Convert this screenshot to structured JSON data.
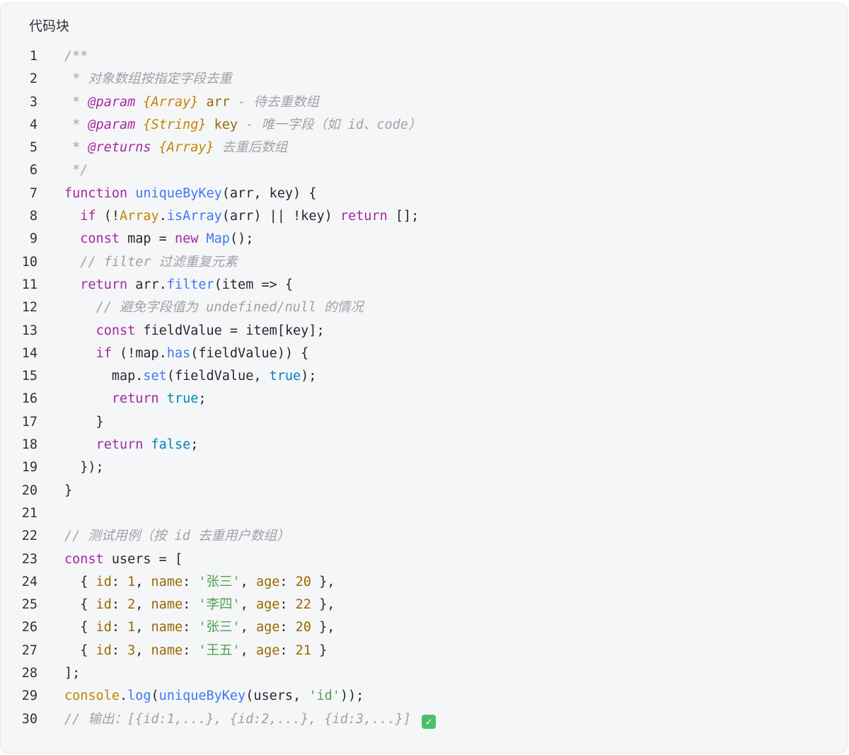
{
  "header": {
    "title": "代码块"
  },
  "theme": {
    "background": "#f5f6f7",
    "keyword": "#a626a4",
    "function": "#4078f2",
    "comment": "#a0a1a7",
    "string": "#50a14f",
    "number": "#986801",
    "boolean": "#0184bc",
    "type": "#c18401"
  },
  "code": {
    "language": "javascript",
    "lines": [
      {
        "n": "1",
        "tokens": [
          [
            "c",
            "/**"
          ]
        ]
      },
      {
        "n": "2",
        "tokens": [
          [
            "c",
            " * 对象数组按指定字段去重"
          ]
        ]
      },
      {
        "n": "3",
        "tokens": [
          [
            "c",
            " * "
          ],
          [
            "tag",
            "@param"
          ],
          [
            "c",
            " "
          ],
          [
            "type",
            "{Array}"
          ],
          [
            "c",
            " "
          ],
          [
            "prop",
            "arr"
          ],
          [
            "c",
            " - 待去重数组"
          ]
        ]
      },
      {
        "n": "4",
        "tokens": [
          [
            "c",
            " * "
          ],
          [
            "tag",
            "@param"
          ],
          [
            "c",
            " "
          ],
          [
            "type",
            "{String}"
          ],
          [
            "c",
            " "
          ],
          [
            "prop",
            "key"
          ],
          [
            "c",
            " - 唯一字段（如 id、code）"
          ]
        ]
      },
      {
        "n": "5",
        "tokens": [
          [
            "c",
            " * "
          ],
          [
            "tag",
            "@returns"
          ],
          [
            "c",
            " "
          ],
          [
            "type",
            "{Array}"
          ],
          [
            "c",
            " 去重后数组"
          ]
        ]
      },
      {
        "n": "6",
        "tokens": [
          [
            "c",
            " */"
          ]
        ]
      },
      {
        "n": "7",
        "tokens": [
          [
            "kw",
            "function"
          ],
          [
            "p",
            " "
          ],
          [
            "fn",
            "uniqueByKey"
          ],
          [
            "p",
            "(arr, key) {"
          ]
        ]
      },
      {
        "n": "8",
        "tokens": [
          [
            "p",
            "  "
          ],
          [
            "kw",
            "if"
          ],
          [
            "p",
            " (!"
          ],
          [
            "obj",
            "Array"
          ],
          [
            "p",
            "."
          ],
          [
            "fn",
            "isArray"
          ],
          [
            "p",
            "(arr) || !key) "
          ],
          [
            "kw",
            "return"
          ],
          [
            "p",
            " [];"
          ]
        ]
      },
      {
        "n": "9",
        "tokens": [
          [
            "p",
            "  "
          ],
          [
            "kw",
            "const"
          ],
          [
            "p",
            " map = "
          ],
          [
            "kw",
            "new"
          ],
          [
            "p",
            " "
          ],
          [
            "fn",
            "Map"
          ],
          [
            "p",
            "();"
          ]
        ]
      },
      {
        "n": "10",
        "tokens": [
          [
            "p",
            "  "
          ],
          [
            "c",
            "// filter 过滤重复元素"
          ]
        ]
      },
      {
        "n": "11",
        "tokens": [
          [
            "p",
            "  "
          ],
          [
            "kw",
            "return"
          ],
          [
            "p",
            " arr."
          ],
          [
            "fn",
            "filter"
          ],
          [
            "p",
            "(item => {"
          ]
        ]
      },
      {
        "n": "12",
        "tokens": [
          [
            "p",
            "    "
          ],
          [
            "c",
            "// 避免字段值为 undefined/null 的情况"
          ]
        ]
      },
      {
        "n": "13",
        "tokens": [
          [
            "p",
            "    "
          ],
          [
            "kw",
            "const"
          ],
          [
            "p",
            " fieldValue = item[key];"
          ]
        ]
      },
      {
        "n": "14",
        "tokens": [
          [
            "p",
            "    "
          ],
          [
            "kw",
            "if"
          ],
          [
            "p",
            " (!map."
          ],
          [
            "fn",
            "has"
          ],
          [
            "p",
            "(fieldValue)) {"
          ]
        ]
      },
      {
        "n": "15",
        "tokens": [
          [
            "p",
            "      map."
          ],
          [
            "fn",
            "set"
          ],
          [
            "p",
            "(fieldValue, "
          ],
          [
            "bool",
            "true"
          ],
          [
            "p",
            ");"
          ]
        ]
      },
      {
        "n": "16",
        "tokens": [
          [
            "p",
            "      "
          ],
          [
            "kw",
            "return"
          ],
          [
            "p",
            " "
          ],
          [
            "bool",
            "true"
          ],
          [
            "p",
            ";"
          ]
        ]
      },
      {
        "n": "17",
        "tokens": [
          [
            "p",
            "    }"
          ]
        ]
      },
      {
        "n": "18",
        "tokens": [
          [
            "p",
            "    "
          ],
          [
            "kw",
            "return"
          ],
          [
            "p",
            " "
          ],
          [
            "bool",
            "false"
          ],
          [
            "p",
            ";"
          ]
        ]
      },
      {
        "n": "19",
        "tokens": [
          [
            "p",
            "  });"
          ]
        ]
      },
      {
        "n": "20",
        "tokens": [
          [
            "p",
            "}"
          ]
        ]
      },
      {
        "n": "21",
        "tokens": [
          [
            "p",
            ""
          ]
        ]
      },
      {
        "n": "22",
        "tokens": [
          [
            "c",
            "// 测试用例（按 id 去重用户数组）"
          ]
        ]
      },
      {
        "n": "23",
        "tokens": [
          [
            "kw",
            "const"
          ],
          [
            "p",
            " users = ["
          ]
        ]
      },
      {
        "n": "24",
        "tokens": [
          [
            "p",
            "  { "
          ],
          [
            "prop",
            "id"
          ],
          [
            "p",
            ": "
          ],
          [
            "num",
            "1"
          ],
          [
            "p",
            ", "
          ],
          [
            "prop",
            "name"
          ],
          [
            "p",
            ": "
          ],
          [
            "str",
            "'张三'"
          ],
          [
            "p",
            ", "
          ],
          [
            "prop",
            "age"
          ],
          [
            "p",
            ": "
          ],
          [
            "num",
            "20"
          ],
          [
            "p",
            " },"
          ]
        ]
      },
      {
        "n": "25",
        "tokens": [
          [
            "p",
            "  { "
          ],
          [
            "prop",
            "id"
          ],
          [
            "p",
            ": "
          ],
          [
            "num",
            "2"
          ],
          [
            "p",
            ", "
          ],
          [
            "prop",
            "name"
          ],
          [
            "p",
            ": "
          ],
          [
            "str",
            "'李四'"
          ],
          [
            "p",
            ", "
          ],
          [
            "prop",
            "age"
          ],
          [
            "p",
            ": "
          ],
          [
            "num",
            "22"
          ],
          [
            "p",
            " },"
          ]
        ]
      },
      {
        "n": "26",
        "tokens": [
          [
            "p",
            "  { "
          ],
          [
            "prop",
            "id"
          ],
          [
            "p",
            ": "
          ],
          [
            "num",
            "1"
          ],
          [
            "p",
            ", "
          ],
          [
            "prop",
            "name"
          ],
          [
            "p",
            ": "
          ],
          [
            "str",
            "'张三'"
          ],
          [
            "p",
            ", "
          ],
          [
            "prop",
            "age"
          ],
          [
            "p",
            ": "
          ],
          [
            "num",
            "20"
          ],
          [
            "p",
            " },"
          ]
        ]
      },
      {
        "n": "27",
        "tokens": [
          [
            "p",
            "  { "
          ],
          [
            "prop",
            "id"
          ],
          [
            "p",
            ": "
          ],
          [
            "num",
            "3"
          ],
          [
            "p",
            ", "
          ],
          [
            "prop",
            "name"
          ],
          [
            "p",
            ": "
          ],
          [
            "str",
            "'王五'"
          ],
          [
            "p",
            ", "
          ],
          [
            "prop",
            "age"
          ],
          [
            "p",
            ": "
          ],
          [
            "num",
            "21"
          ],
          [
            "p",
            " }"
          ]
        ]
      },
      {
        "n": "28",
        "tokens": [
          [
            "p",
            "];"
          ]
        ]
      },
      {
        "n": "29",
        "tokens": [
          [
            "obj",
            "console"
          ],
          [
            "p",
            "."
          ],
          [
            "fn",
            "log"
          ],
          [
            "p",
            "("
          ],
          [
            "fn",
            "uniqueByKey"
          ],
          [
            "p",
            "(users, "
          ],
          [
            "str",
            "'id'"
          ],
          [
            "p",
            "));"
          ]
        ]
      },
      {
        "n": "30",
        "tokens": [
          [
            "c",
            "// 输出：[{id:1,...}, {id:2,...}, {id:3,...}] "
          ],
          [
            "check",
            "✓"
          ]
        ]
      }
    ]
  }
}
